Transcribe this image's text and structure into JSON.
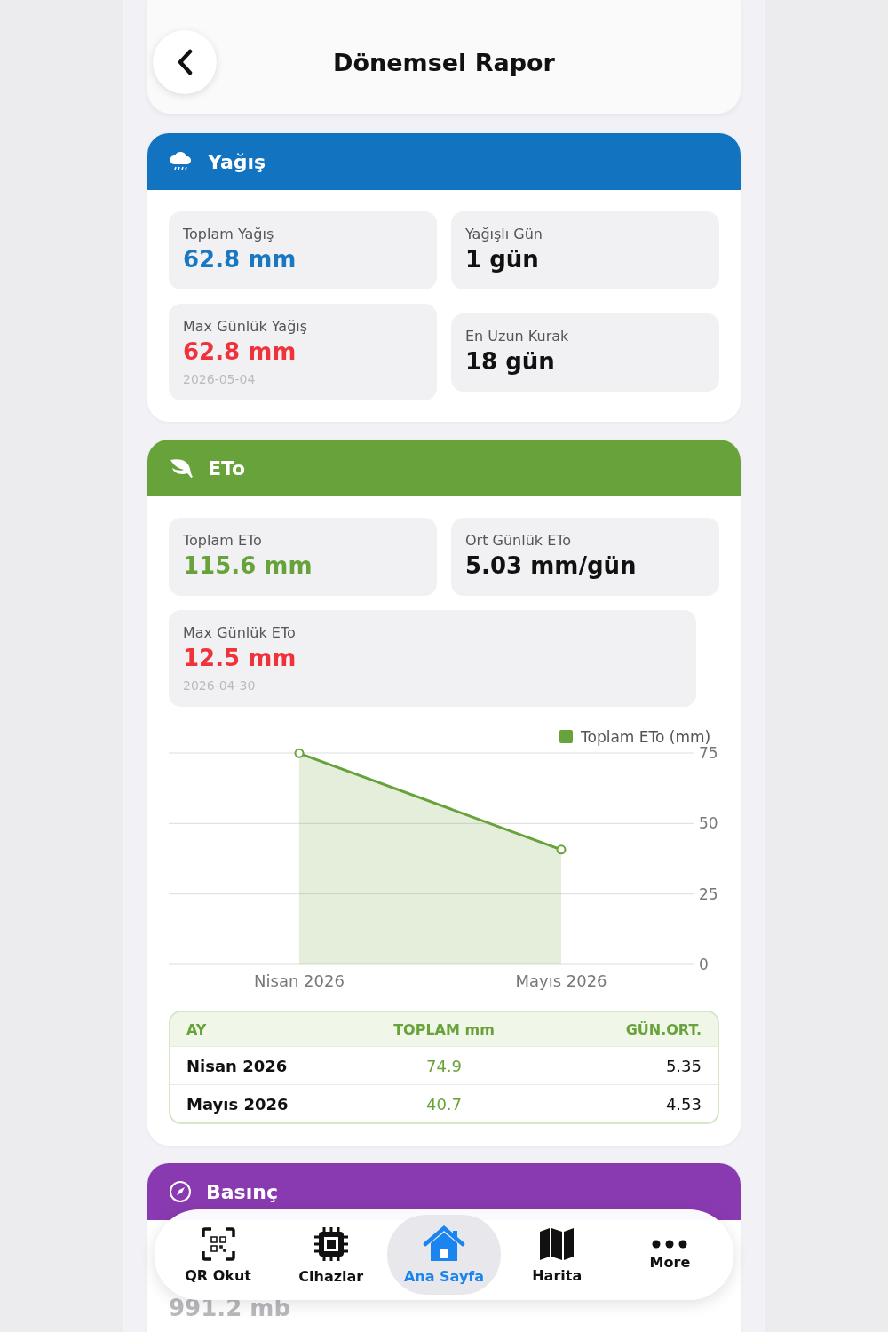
{
  "header": {
    "title": "Dönemsel Rapor"
  },
  "sections": [
    {
      "kind": "rain",
      "title": "Yağış",
      "color": "#1273c0",
      "stats": [
        {
          "label": "Toplam Yağış",
          "value": "62.8 mm",
          "color": "#1a78c2"
        },
        {
          "label": "Yağışlı Gün",
          "value": "1 gün",
          "color": "#111111"
        },
        {
          "label": "Max Günlük Yağış",
          "value": "62.8 mm",
          "color": "#f0323a",
          "date": "2026-05-04"
        },
        {
          "label": "En Uzun Kurak",
          "value": "18 gün",
          "color": "#111111"
        }
      ]
    },
    {
      "kind": "eto",
      "title": "ETo",
      "color": "#67a23a",
      "stats": [
        {
          "label": "Toplam ETo",
          "value": "115.6 mm",
          "color": "#67a23a"
        },
        {
          "label": "Ort Günlük ETo",
          "value": "5.03 mm/gün",
          "color": "#111111"
        },
        {
          "label": "Max Günlük ETo",
          "value": "12.5 mm",
          "color": "#f0323a",
          "date": "2026-04-30"
        }
      ],
      "chart_data": {
        "type": "area",
        "categories": [
          "Nisan 2026",
          "Mayıs 2026"
        ],
        "series": [
          {
            "name": "Toplam ETo (mm)",
            "color": "#67a23a",
            "values": [
              74.9,
              40.7
            ]
          }
        ],
        "ylim": [
          0,
          75
        ],
        "yticks": [
          0,
          25,
          50,
          75
        ]
      },
      "table": {
        "columns": [
          "AY",
          "TOPLAM mm",
          "GÜN.ORT."
        ],
        "rows": [
          [
            "Nisan 2026",
            "74.9",
            "5.35"
          ],
          [
            "Mayıs 2026",
            "40.7",
            "4.53"
          ]
        ]
      }
    },
    {
      "kind": "pressure",
      "title": "Basınç",
      "color": "#8a3ab0",
      "stats": [
        {
          "value": "991.2 mb",
          "color": "#b9b9bd"
        }
      ]
    }
  ],
  "tab_bar": [
    {
      "kind": "qr",
      "label": "QR Okut",
      "selected": false
    },
    {
      "kind": "chip",
      "label": "Cihazlar",
      "selected": false
    },
    {
      "kind": "home",
      "label": "Ana Sayfa",
      "selected": true
    },
    {
      "kind": "map",
      "label": "Harita",
      "selected": false
    },
    {
      "kind": "more",
      "label": "More",
      "selected": false
    }
  ]
}
